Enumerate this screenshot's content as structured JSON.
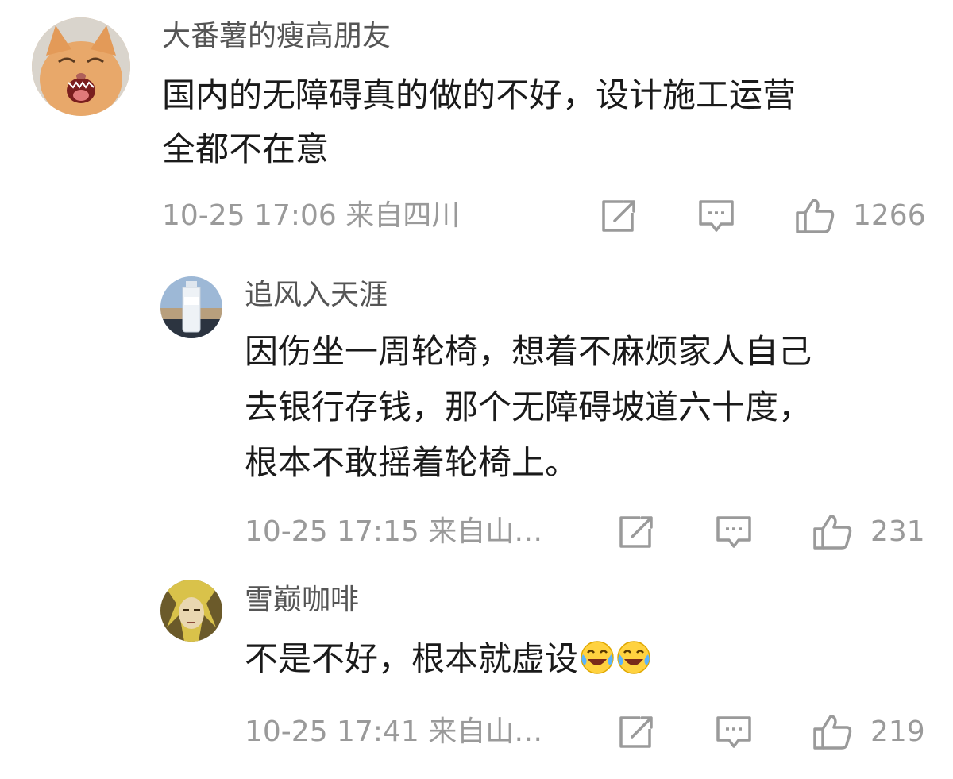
{
  "comments": [
    {
      "username": "大番薯的瘦高朋友",
      "lines": [
        "国内的无障碍真的做的不好，设计施工运营",
        "全都不在意"
      ],
      "timestamp": "10-25 17:06",
      "location": "来自四川",
      "likes": "1266",
      "avatar": "cat-laughing"
    },
    {
      "username": "追风入天涯",
      "lines": [
        "因伤坐一周轮椅，想着不麻烦家人自己",
        "去银行存钱，那个无障碍坡道六十度，",
        "根本不敢摇着轮椅上。"
      ],
      "timestamp": "10-25 17:15",
      "location": "来自山…",
      "likes": "231",
      "avatar": "water-bottle"
    },
    {
      "username": "雪巅咖啡",
      "lines": [
        "不是不好，根本就虚设"
      ],
      "emojis": [
        "laugh-cry-emoji",
        "laugh-cry-emoji"
      ],
      "timestamp": "10-25 17:41",
      "location": "来自山…",
      "likes": "219",
      "avatar": "anime-character"
    }
  ],
  "icons": {
    "share": "share-icon",
    "reply": "comment-icon",
    "like": "thumbs-up-icon"
  },
  "colors": {
    "text": "#1a1a1a",
    "username": "#555555",
    "meta": "#9a9a9a"
  }
}
